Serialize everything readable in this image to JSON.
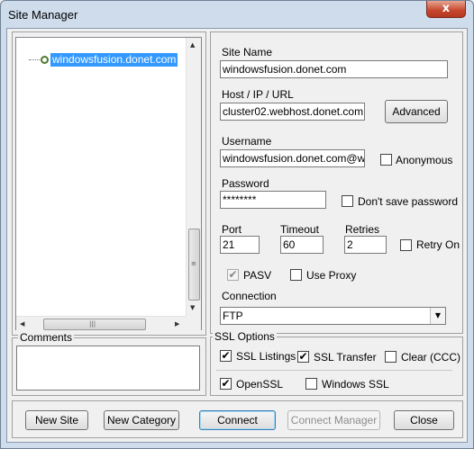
{
  "window": {
    "title": "Site Manager",
    "close_glyph": "x"
  },
  "tree": {
    "selected_item": "windowsfusion.donet.com",
    "scroll_up_glyph": "▲",
    "scroll_down_glyph": "▼",
    "scroll_left_glyph": "◀",
    "scroll_right_glyph": "▶",
    "grip_v": "≡",
    "grip_h": "|||"
  },
  "comments": {
    "title": "Comments",
    "value": ""
  },
  "fields": {
    "site_name": {
      "label": "Site Name",
      "value": "windowsfusion.donet.com"
    },
    "host": {
      "label": "Host / IP / URL",
      "value": "cluster02.webhost.donet.com"
    },
    "advanced_label": "Advanced",
    "username": {
      "label": "Username",
      "value": "windowsfusion.donet.com@windowsfusion"
    },
    "anonymous_label": "Anonymous",
    "password": {
      "label": "Password",
      "value": "********"
    },
    "dont_save_label": "Don't save password",
    "port": {
      "label": "Port",
      "value": "21"
    },
    "timeout": {
      "label": "Timeout",
      "value": "60"
    },
    "retries": {
      "label": "Retries",
      "value": "2"
    },
    "retry_on_label": "Retry On",
    "pasv_label": "PASV",
    "use_proxy_label": "Use Proxy",
    "connection": {
      "label": "Connection",
      "value": "FTP"
    }
  },
  "ssl": {
    "title": "SSL Options",
    "listings_label": "SSL Listings",
    "transfer_label": "SSL Transfer",
    "clear_label": "Clear (CCC)",
    "openssl_label": "OpenSSL",
    "windows_ssl_label": "Windows SSL"
  },
  "checks": {
    "checked_glyph": "✔"
  },
  "buttons": {
    "new_site": "New Site",
    "new_category": "New Category",
    "connect": "Connect",
    "connect_manager": "Connect Manager",
    "close": "Close"
  }
}
